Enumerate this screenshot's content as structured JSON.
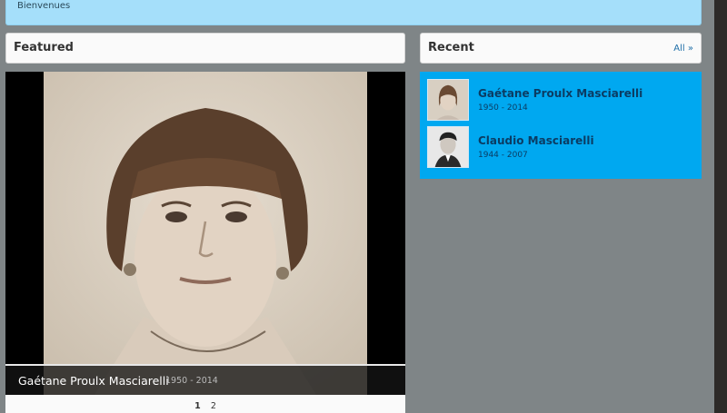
{
  "banner": {
    "text": "Bienvenues"
  },
  "featured": {
    "title": "Featured",
    "slide": {
      "name": "Gaétane Proulx Masciarelli",
      "years": "1950 - 2014",
      "icon": "portrait-photo-icon"
    },
    "pager": [
      "1",
      "2"
    ],
    "active_page": "1"
  },
  "recent": {
    "title": "Recent",
    "all_label": "All »",
    "items": [
      {
        "name": "Gaétane Proulx Masciarelli",
        "years": "1950 - 2014"
      },
      {
        "name": "Claudio Masciarelli",
        "years": "1944 - 2007"
      }
    ]
  },
  "colors": {
    "banner": "#a5dffa",
    "recent_bg": "#00a8f0",
    "page_bg": "#7f8587",
    "link": "#1f6fa8"
  }
}
